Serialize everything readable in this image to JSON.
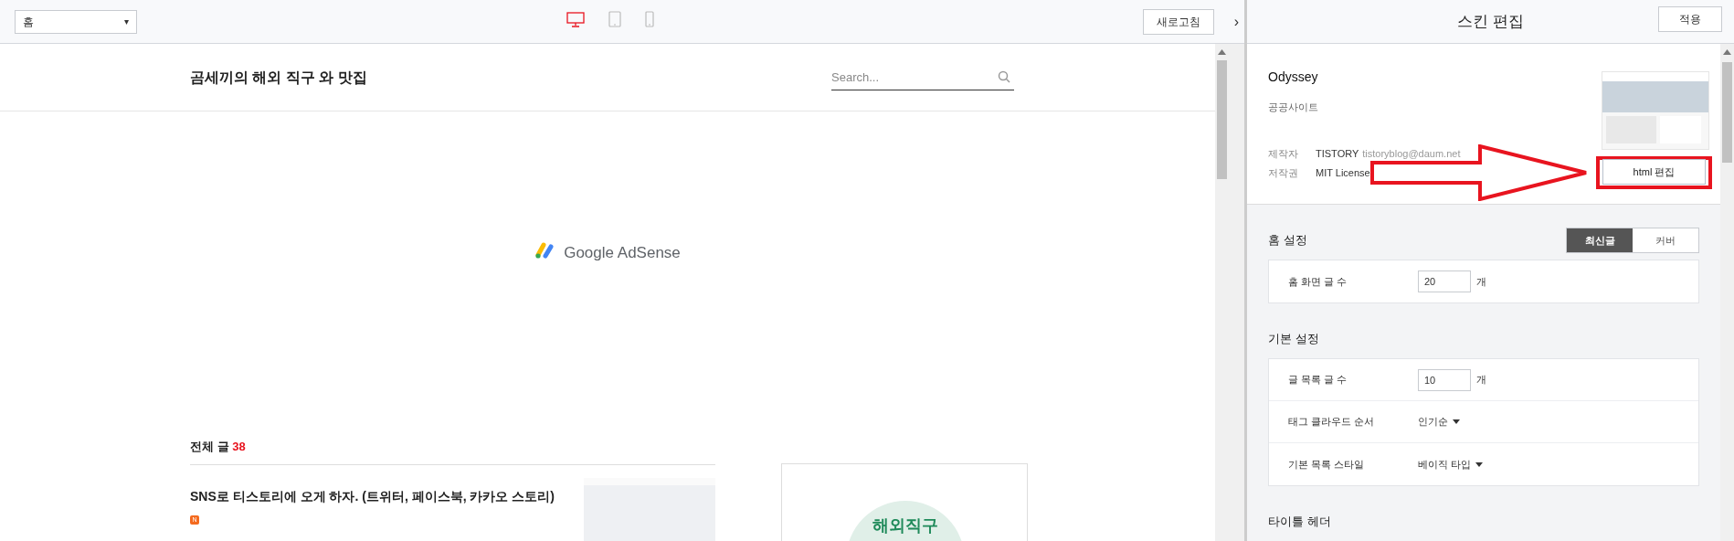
{
  "toolbar": {
    "page_select": "홈",
    "caret": "▾",
    "devices": [
      {
        "kind": "desktop",
        "selected": true
      },
      {
        "kind": "tablet",
        "selected": false
      },
      {
        "kind": "mobile",
        "selected": false
      }
    ],
    "refresh_button": "새로고침",
    "collapse": "›"
  },
  "preview": {
    "blog_title": "곰세끼의 해외 직구 와 맛집",
    "search": {
      "placeholder": "Search..."
    },
    "ad_label": "Google AdSense",
    "post_list": {
      "heading": "전체 글",
      "count": "38"
    },
    "posts": [
      {
        "title": "SNS로 티스토리에 오게 하자. (트위터, 페이스북, 카카오 스토리)",
        "new_badge": "N"
      }
    ],
    "side_banner": {
      "text": "해외직구"
    }
  },
  "panel": {
    "title": "스킨 편집",
    "apply_button": "적용",
    "skin": {
      "name": "Odyssey",
      "description": "공공사이트",
      "author_label": "제작자",
      "author": "TISTORY",
      "email": "tistoryblog@daum.net",
      "license_label": "저작권",
      "license": "MIT License",
      "html_button": "html 편집"
    },
    "sections": [
      {
        "title": "홈 설정",
        "tabs": [
          {
            "label": "최신글",
            "selected": true
          },
          {
            "label": "커버",
            "selected": false
          }
        ],
        "rows": [
          {
            "kind": "number",
            "label": "홈 화면 글 수",
            "value": "20",
            "unit": "개"
          }
        ]
      },
      {
        "title": "기본 설정",
        "rows": [
          {
            "kind": "number",
            "label": "글 목록 글 수",
            "value": "10",
            "unit": "개"
          },
          {
            "kind": "dropdown",
            "label": "태그 클라우드 순서",
            "value": "인기순"
          },
          {
            "kind": "dropdown",
            "label": "기본 목록 스타일",
            "value": "베이직 타입"
          }
        ]
      },
      {
        "title": "타이틀 헤더"
      }
    ]
  }
}
